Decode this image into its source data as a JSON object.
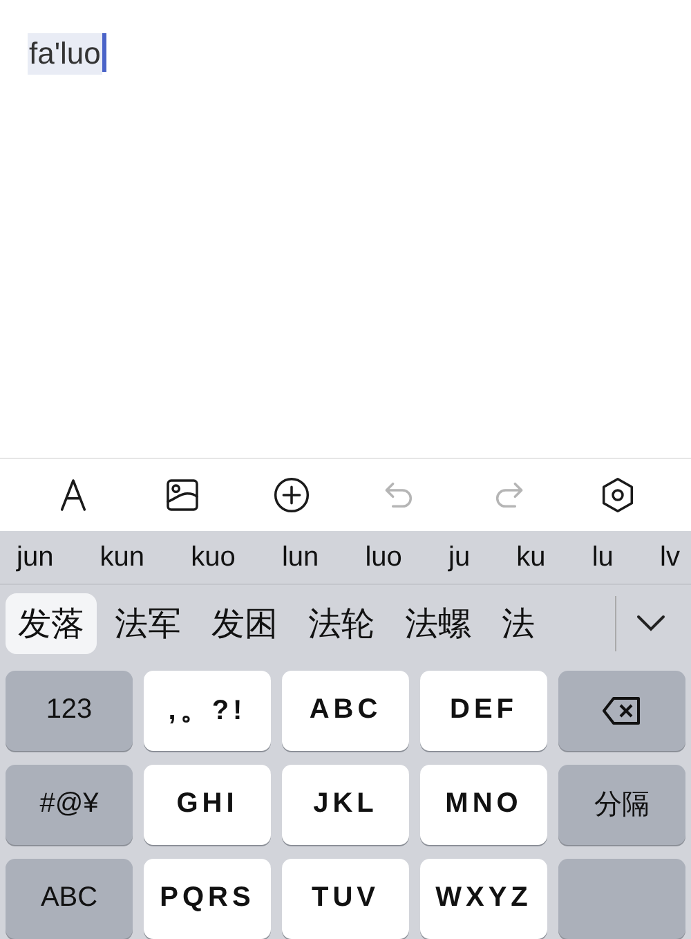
{
  "editor": {
    "composing_text": "fa'luo"
  },
  "toolbar": [
    {
      "kind": "font",
      "disabled": false
    },
    {
      "kind": "image",
      "disabled": false
    },
    {
      "kind": "add",
      "disabled": false
    },
    {
      "kind": "undo",
      "disabled": true
    },
    {
      "kind": "redo",
      "disabled": true
    },
    {
      "kind": "settings",
      "disabled": false
    }
  ],
  "pinyin_options": [
    "jun",
    "kun",
    "kuo",
    "lun",
    "luo",
    "ju",
    "ku",
    "lu",
    "lv"
  ],
  "candidates": [
    {
      "label": "发落",
      "selected": true
    },
    {
      "label": "法军",
      "selected": false
    },
    {
      "label": "发困",
      "selected": false
    },
    {
      "label": "法轮",
      "selected": false
    },
    {
      "label": "法螺",
      "selected": false
    },
    {
      "label": "法",
      "selected": false
    }
  ],
  "keys": [
    {
      "label": "123",
      "kind": "function"
    },
    {
      "label": ",。?!",
      "kind": "letter"
    },
    {
      "label": "ABC",
      "kind": "letter"
    },
    {
      "label": "DEF",
      "kind": "letter"
    },
    {
      "kind": "delete"
    },
    {
      "label": "#@¥",
      "kind": "function"
    },
    {
      "label": "GHI",
      "kind": "letter"
    },
    {
      "label": "JKL",
      "kind": "letter"
    },
    {
      "label": "MNO",
      "kind": "letter"
    },
    {
      "label": "分隔",
      "kind": "function"
    },
    {
      "label": "ABC",
      "kind": "function"
    },
    {
      "label": "PQRS",
      "kind": "letter"
    },
    {
      "label": "TUV",
      "kind": "letter"
    },
    {
      "label": "WXYZ",
      "kind": "letter"
    },
    {
      "kind": "blank"
    }
  ]
}
